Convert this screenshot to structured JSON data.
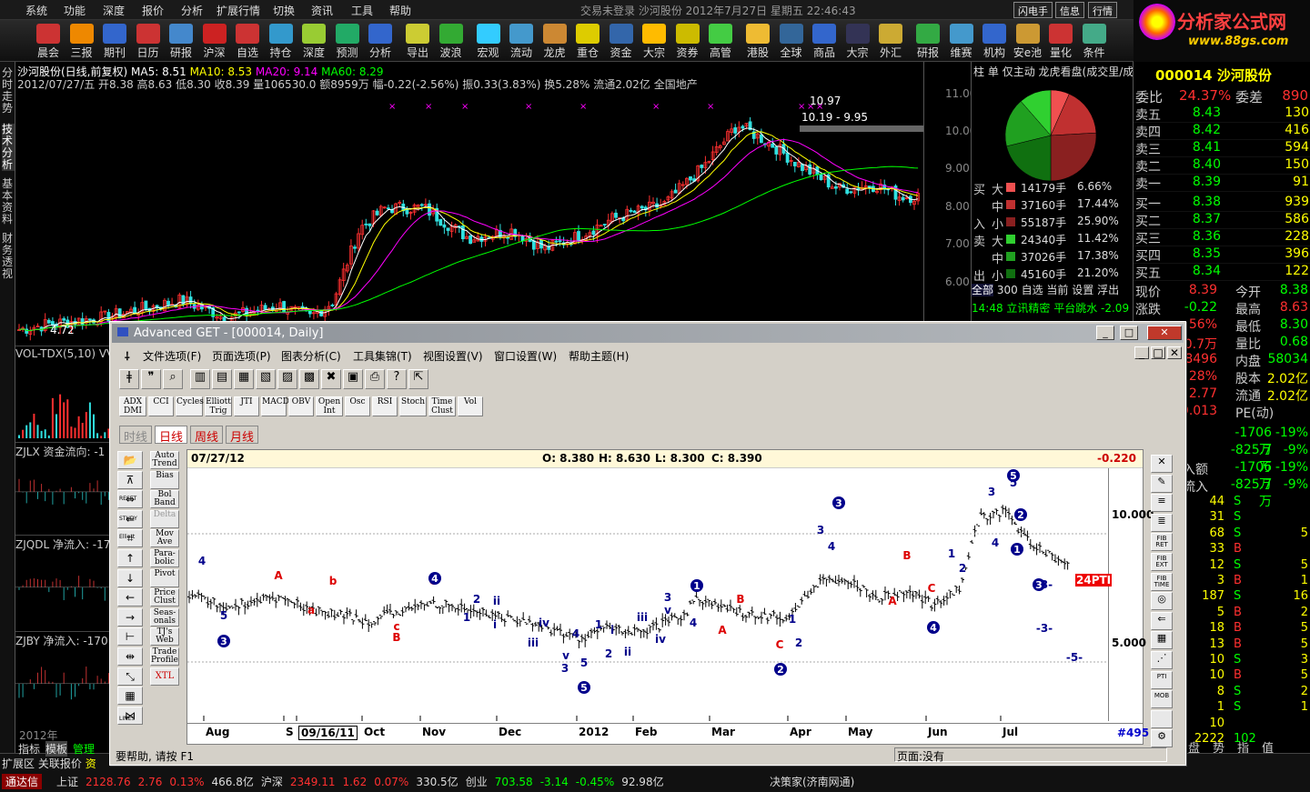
{
  "menu": {
    "items": [
      "系统",
      "功能",
      "深度",
      "报价",
      "分析",
      "扩展行情",
      "切换",
      "资讯",
      "工具",
      "帮助"
    ],
    "center": "交易未登录 沙河股份 2012年7月27日 星期五 22:46:43",
    "right_buttons": [
      "闪电手",
      "信息",
      "行情"
    ]
  },
  "logo": {
    "text": "分析家公式网",
    "url": "www.88gs.com"
  },
  "toolbar": {
    "items": [
      "晨会",
      "三报",
      "期刊",
      "日历",
      "研报",
      "沪深",
      "自选",
      "持仓",
      "深度",
      "预测",
      "分析",
      "导出",
      "波浪",
      "宏观",
      "流动性",
      "龙虎榜",
      "重仓股",
      "资金",
      "大宗",
      "资券",
      "高管",
      "港股",
      "全球",
      "商品",
      "大宗",
      "外汇",
      "研报",
      "维赛特",
      "机构池",
      "安e池",
      "量化池",
      "条件选"
    ]
  },
  "left_tabs": [
    "分时走势",
    "技术分析",
    "基本资料",
    "财务透视"
  ],
  "chart": {
    "title": "沙河股份(日线,前复权)",
    "ma": {
      "ma5": "MA5: 8.51",
      "ma10": "MA10: 8.53",
      "ma20": "MA20: 9.14",
      "ma60": "MA60: 8.29"
    },
    "info": "2012/07/27/五 开8.38 高8.63 低8.30 收8.39 量106530.0 额8959万 幅-0.22(-2.56%) 振0.33(3.83%) 换5.28% 流通2.02亿 全国地产",
    "yaxis": [
      "11.00",
      "10.00",
      "9.00",
      "8.00",
      "7.00",
      "6.00"
    ],
    "hi_label": "10.97",
    "range_label": "10.19 - 9.95",
    "lo_label": "4.72",
    "indicators": [
      "VOL-TDX(5,10) VV",
      "ZJLX 资金流向: -1",
      "ZJQDL 净流入: -17",
      "ZJBY 净流入: -170"
    ],
    "date_mark": "2012年"
  },
  "rightpanel": {
    "tabs": [
      "柱",
      "单",
      "仅主动",
      "龙虎看盘(成交里/成"
    ],
    "rows": [
      {
        "side": "买",
        "size": "大",
        "vol": "14179手",
        "pct": "6.66%",
        "color": "#f05050"
      },
      {
        "side": "",
        "size": "中",
        "vol": "37160手",
        "pct": "17.44%",
        "color": "#c03030"
      },
      {
        "side": "入",
        "size": "小",
        "vol": "55187手",
        "pct": "25.90%",
        "color": "#8a2020"
      },
      {
        "side": "卖",
        "size": "大",
        "vol": "24340手",
        "pct": "11.42%",
        "color": "#30d030"
      },
      {
        "side": "",
        "size": "中",
        "vol": "37026手",
        "pct": "17.38%",
        "color": "#20a020"
      },
      {
        "side": "出",
        "size": "小",
        "vol": "45160手",
        "pct": "21.20%",
        "color": "#107010"
      }
    ],
    "bottom_tabs": [
      "全部",
      "300",
      "自选",
      "当前",
      "设置",
      "浮出"
    ],
    "news": [
      "14:48 立讯精密 平台跳水 -2.09"
    ]
  },
  "quote": {
    "code": "000014",
    "name": "沙河股份",
    "weibi": {
      "label": "委比",
      "value": "24.37%",
      "label2": "委差",
      "value2": "890"
    },
    "sells": [
      {
        "k": "卖五",
        "p": "8.43",
        "n": "130"
      },
      {
        "k": "卖四",
        "p": "8.42",
        "n": "416"
      },
      {
        "k": "卖三",
        "p": "8.41",
        "n": "594"
      },
      {
        "k": "卖二",
        "p": "8.40",
        "n": "150"
      },
      {
        "k": "卖一",
        "p": "8.39",
        "n": "91"
      }
    ],
    "buys": [
      {
        "k": "买一",
        "p": "8.38",
        "n": "939"
      },
      {
        "k": "买二",
        "p": "8.37",
        "n": "586"
      },
      {
        "k": "买三",
        "p": "8.36",
        "n": "228"
      },
      {
        "k": "买四",
        "p": "8.35",
        "n": "396"
      },
      {
        "k": "买五",
        "p": "8.34",
        "n": "122"
      }
    ],
    "stats": [
      [
        "现价",
        "8.39",
        "今开",
        "8.38"
      ],
      [
        "涨跌",
        "-0.22",
        "最高",
        "8.63"
      ],
      [
        "",
        "56%",
        "最低",
        "8.30"
      ],
      [
        "",
        "0.7万",
        "量比",
        "0.68"
      ],
      [
        "",
        "8496",
        "内盘",
        "58034"
      ],
      [
        "",
        "28%",
        "股本",
        "2.02亿"
      ],
      [
        "",
        "2.77",
        "流通",
        "2.02亿"
      ],
      [
        "",
        "0.013",
        "PE(动)",
        ""
      ]
    ],
    "flows": [
      [
        "",
        "-1706万",
        "-19%"
      ],
      [
        "",
        "-825.7万",
        "-9%"
      ],
      [
        "入额",
        "-1706万",
        "-19%"
      ],
      [
        "流入",
        "-825.7万",
        "-9%"
      ]
    ],
    "ticks": [
      [
        "8.38",
        "44",
        "S"
      ],
      [
        "8.38",
        "31",
        "S"
      ],
      [
        "8.38",
        "68",
        "S"
      ],
      [
        "8.39",
        "33",
        "B"
      ],
      [
        "8.39",
        "12",
        "S"
      ],
      [
        "8.40",
        "3",
        "B"
      ],
      [
        "8.38",
        "187",
        "S"
      ],
      [
        "8.38",
        "5",
        "B"
      ],
      [
        "8.39",
        "18",
        "B"
      ],
      [
        "8.39",
        "13",
        "B"
      ],
      [
        "8.39",
        "10",
        "S"
      ],
      [
        "8.38",
        "10",
        "B"
      ],
      [
        "8.38",
        "8",
        "S"
      ],
      [
        "8.38",
        "1",
        "S"
      ],
      [
        "8.38",
        "10",
        ""
      ],
      [
        "",
        "2222",
        "102"
      ]
    ],
    "tick_extra": [
      "",
      "",
      "5",
      "",
      "5",
      "1",
      "16",
      "2",
      "5",
      "5",
      "3",
      "5",
      "2",
      "1",
      "",
      ""
    ],
    "bottom_tabs": [
      "盘",
      "势",
      "指",
      "值"
    ]
  },
  "bottombar": {
    "tabs": [
      "扩展区",
      "关联报价",
      "资"
    ],
    "left_tabs": [
      "指标",
      "模板",
      "管理"
    ],
    "indices": [
      {
        "name": "上证",
        "v": "2128.76",
        "c": "2.76",
        "p": "0.13%",
        "a": "466.8亿"
      },
      {
        "name": "沪深",
        "v": "2349.11",
        "c": "1.62",
        "p": "0.07%",
        "a": "330.5亿"
      },
      {
        "name": "创业",
        "v": "703.58",
        "c": "-3.14",
        "p": "-0.45%",
        "a": "92.98亿"
      }
    ],
    "app": "通达信",
    "right": "决策家(济南网通)"
  },
  "window": {
    "title": "Advanced GET - [000014, Daily]",
    "menu": [
      "文件选项(F)",
      "页面选项(P)",
      "图表分析(C)",
      "工具集锦(T)",
      "视图设置(V)",
      "窗口设置(W)",
      "帮助主题(H)"
    ],
    "indicator_buttons": [
      "ADX DMI",
      "CCI",
      "Cycles",
      "Elliott Trig",
      "JTI",
      "MACD",
      "OBV",
      "Open Int",
      "Osc",
      "RSI",
      "Stoch",
      "Time Clust",
      "Vol"
    ],
    "period_tabs": [
      "时线",
      "日线",
      "周线",
      "月线"
    ],
    "left_buttons": [
      "Auto Trend",
      "Bias",
      "Bol Band",
      "Delta",
      "Mov Ave",
      "Para-bolic",
      "Pivot",
      "Price Clust",
      "Seas-onals",
      "TJ's Web",
      "Trade Profile",
      "XTL"
    ],
    "left_icons": [
      "RESET",
      "STUDY",
      "Elliott",
      "LINES"
    ],
    "right_buttons": [
      "FIB RET",
      "FIB EXT",
      "FIB TIME",
      "PTI",
      "MOB"
    ],
    "header": {
      "date": "07/27/12",
      "o": "O: 8.380",
      "h": "H: 8.630",
      "l": "L: 8.300",
      "c": "C: 8.390",
      "chg": "-0.220"
    },
    "yaxis": [
      "10.000",
      "5.000"
    ],
    "xaxis": [
      "Aug",
      "S",
      "09/16/11",
      "Oct",
      "Nov",
      "Dec",
      "2012",
      "Feb",
      "Mar",
      "Apr",
      "May",
      "Jun",
      "Jul"
    ],
    "bar_count": "#495",
    "pti": "24PTI",
    "status_left": "要帮助, 请按 F1",
    "status_right": "页面:没有"
  }
}
